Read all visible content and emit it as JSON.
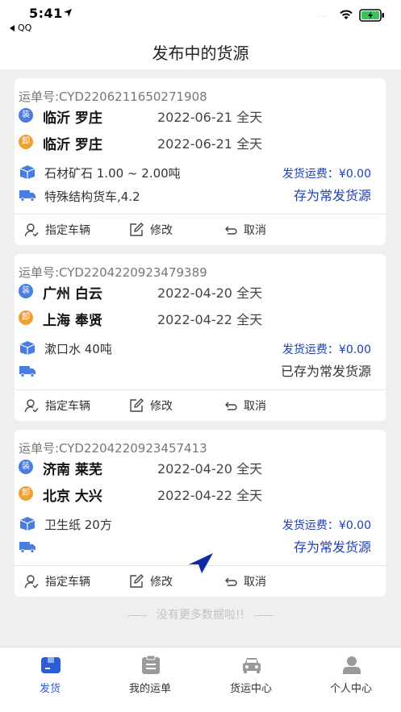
{
  "status_bar": {
    "time": "5:41",
    "back_app": "QQ",
    "signal": "····"
  },
  "header": {
    "title": "发布中的货源"
  },
  "colors": {
    "accent": "#2a5dd7",
    "freight_blue": "#1f3fb5",
    "load_badge": "#4a7ddf",
    "unload_badge": "#f0a030"
  },
  "cards": [
    {
      "order_no": "运单号:CYD2206211650271908",
      "load": {
        "badge": "装",
        "place": "临沂 罗庄",
        "date": "2022-06-21 全天"
      },
      "unload": {
        "badge": "卸",
        "place": "临沂 罗庄",
        "date": "2022-06-21 全天"
      },
      "goods": "石材矿石 1.00 ~ 2.00吨",
      "vehicle": "特殊结构货车,4.2",
      "freight_label": "发货运费：",
      "freight_value": "¥0.00",
      "save_label": "存为常发货源",
      "saved": false,
      "actions": {
        "assign": "指定车辆",
        "edit": "修改",
        "cancel": "取消"
      }
    },
    {
      "order_no": "运单号:CYD2204220923479389",
      "load": {
        "badge": "装",
        "place": "广州 白云",
        "date": "2022-04-20 全天"
      },
      "unload": {
        "badge": "卸",
        "place": "上海 奉贤",
        "date": "2022-04-22 全天"
      },
      "goods": "漱口水  40吨",
      "vehicle": "",
      "freight_label": "发货运费：",
      "freight_value": "¥0.00",
      "save_label": "已存为常发货源",
      "saved": true,
      "actions": {
        "assign": "指定车辆",
        "edit": "修改",
        "cancel": "取消"
      }
    },
    {
      "order_no": "运单号:CYD2204220923457413",
      "load": {
        "badge": "装",
        "place": "济南 莱芜",
        "date": "2022-04-20 全天"
      },
      "unload": {
        "badge": "卸",
        "place": "北京 大兴",
        "date": "2022-04-22 全天"
      },
      "goods": "卫生纸  20方",
      "vehicle": "",
      "freight_label": "发货运费：",
      "freight_value": "¥0.00",
      "save_label": "存为常发货源",
      "saved": false,
      "actions": {
        "assign": "指定车辆",
        "edit": "修改",
        "cancel": "取消"
      }
    }
  ],
  "list_end_text": "没有更多数据啦!!",
  "tabs": [
    {
      "label": "发货",
      "icon": "ship-box-icon",
      "active": true
    },
    {
      "label": "我的运单",
      "icon": "waybill-icon",
      "active": false
    },
    {
      "label": "货运中心",
      "icon": "car-icon",
      "active": false
    },
    {
      "label": "个人中心",
      "icon": "person-icon",
      "active": false
    }
  ]
}
